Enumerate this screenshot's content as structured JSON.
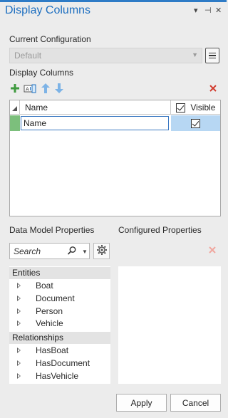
{
  "pane": {
    "title": "Display Columns",
    "controls": [
      "▾",
      "⊣",
      "✕"
    ]
  },
  "configuration": {
    "label": "Current Configuration",
    "value": "Default"
  },
  "columns_section": {
    "label": "Display Columns"
  },
  "toolbar": {
    "icons": [
      "add-icon",
      "rename-field-icon",
      "move-up-icon",
      "move-down-icon",
      "delete-icon"
    ]
  },
  "grid": {
    "headers": {
      "name": "Name",
      "visible": "Visible"
    },
    "rows": [
      {
        "name": "Name",
        "visible": true
      }
    ]
  },
  "data_model": {
    "label": "Data Model Properties",
    "search_placeholder": "Search",
    "groups": [
      {
        "title": "Entities",
        "items": [
          "Boat",
          "Document",
          "Person",
          "Vehicle"
        ]
      },
      {
        "title": "Relationships",
        "items": [
          "HasBoat",
          "HasDocument",
          "HasVehicle"
        ]
      }
    ]
  },
  "configured": {
    "label": "Configured Properties"
  },
  "buttons": {
    "apply": "Apply",
    "cancel": "Cancel"
  },
  "colors": {
    "accent": "#1e6fc0",
    "add": "#3f9a3f",
    "delete": "#d13c2f",
    "row_selected": "#b7d7f3"
  }
}
